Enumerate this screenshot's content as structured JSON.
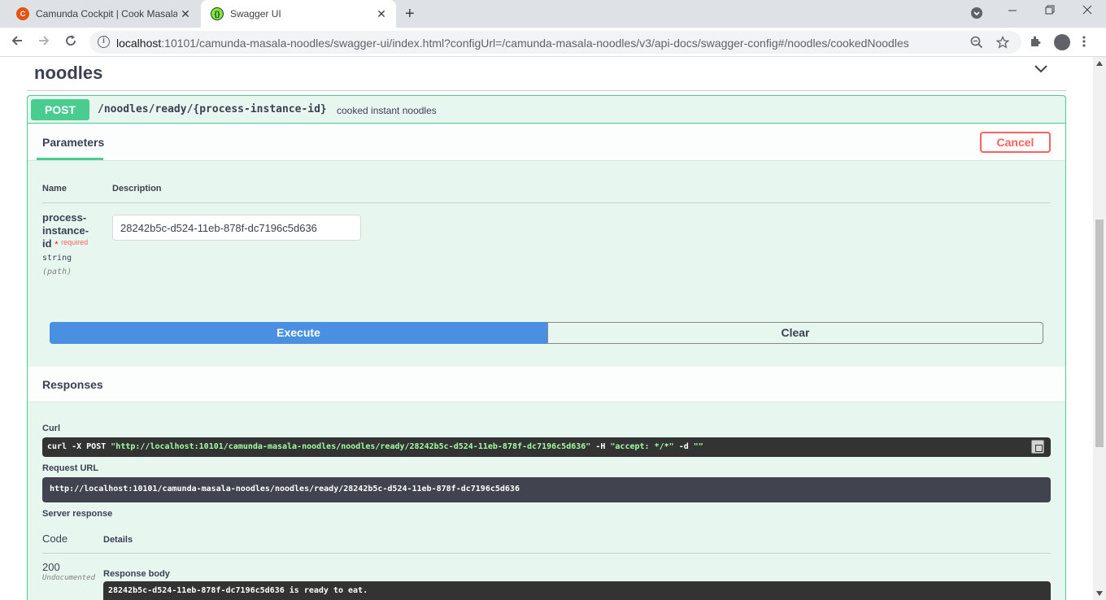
{
  "browser": {
    "tabs": [
      {
        "title": "Camunda Cockpit | Cook Masala",
        "favicon": "camunda-icon"
      },
      {
        "title": "Swagger UI",
        "favicon": "swagger-icon"
      }
    ],
    "close_glyph": "✕",
    "new_tab_glyph": "+",
    "url_host": "localhost",
    "url_rest": ":10101/camunda-masala-noodles/swagger-ui/index.html?configUrl=/camunda-masala-noodles/v3/api-docs/swagger-config#/noodles/cookedNoodles"
  },
  "page": {
    "tag_title": "noodles",
    "operation": {
      "method": "POST",
      "path": "/noodles/ready/{process-instance-id}",
      "summary": "cooked instant noodles"
    },
    "parameters": {
      "tab_label": "Parameters",
      "cancel_label": "Cancel",
      "col_name": "Name",
      "col_description": "Description",
      "param": {
        "name_line1": "process-",
        "name_line2": "instance-",
        "name_line3": "id",
        "required_star": "*",
        "required_label": "required",
        "type": "string",
        "in": "(path)",
        "value": "28242b5c-d524-11eb-878f-dc7196c5d636"
      },
      "execute_label": "Execute",
      "clear_label": "Clear"
    },
    "responses": {
      "title": "Responses",
      "curl_label": "Curl",
      "curl_cmd_start": "curl -X POST ",
      "curl_url": "\"http://localhost:10101/camunda-masala-noodles/noodles/ready/28242b5c-d524-11eb-878f-dc7196c5d636\"",
      "curl_h": " -H  ",
      "curl_header": "\"accept: */*\"",
      "curl_d": " -d ",
      "curl_data": "\"\"",
      "request_url_label": "Request URL",
      "request_url": "http://localhost:10101/camunda-masala-noodles/noodles/ready/28242b5c-d524-11eb-878f-dc7196c5d636",
      "server_response_label": "Server response",
      "code_header": "Code",
      "details_header": "Details",
      "code": "200",
      "undocumented": "Undocumented",
      "response_body_label": "Response body",
      "response_body": "28242b5c-d524-11eb-878f-dc7196c5d636 is ready to eat."
    }
  }
}
